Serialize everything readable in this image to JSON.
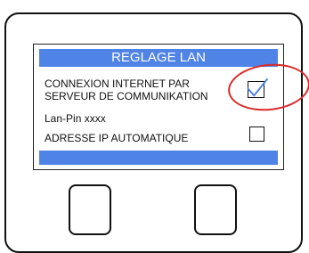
{
  "screen": {
    "title": "REGLAGE LAN",
    "connection_label_line1": "CONNEXION INTERNET PAR",
    "connection_label_line2": "SERVEUR DE COMMUNIKATION",
    "connection_checked": true,
    "lanpin_label": "Lan-Pin",
    "lanpin_value": "xxxx",
    "auto_ip_label": "ADRESSE IP AUTOMATIQUE",
    "auto_ip_checked": false
  },
  "icons": {
    "checkmark": "check-icon",
    "highlight": "red-circle-annotation"
  },
  "colors": {
    "bar_blue": "#4f83e6",
    "check_blue": "#4f83e6",
    "highlight_red": "#d92b2b"
  }
}
